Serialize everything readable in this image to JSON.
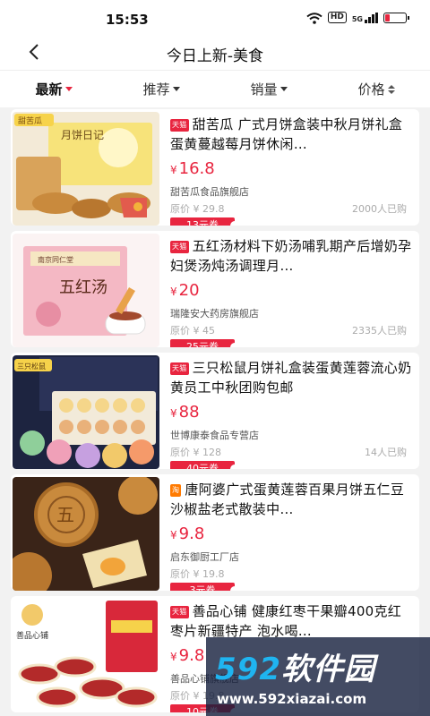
{
  "status": {
    "time": "15:53",
    "hd": "HD",
    "signal": "5G"
  },
  "nav": {
    "title": "今日上新-美食"
  },
  "tabs": [
    {
      "label": "最新",
      "active": true
    },
    {
      "label": "推荐"
    },
    {
      "label": "销量"
    },
    {
      "label": "价格"
    }
  ],
  "products": [
    {
      "badge": "天猫",
      "title": "甜苦瓜 广式月饼盒装中秋月饼礼盒蛋黄蔓越莓月饼休闲…",
      "price": "16.8",
      "shop": "甜苦瓜食品旗舰店",
      "original": "原价 ¥ 29.8",
      "sold": "2000人已购",
      "coupon": "13元券"
    },
    {
      "badge": "天猫",
      "title": "五红汤材料下奶汤哺乳期产后增奶孕妇煲汤炖汤调理月…",
      "price": "20",
      "shop": "瑞隆安大药房旗舰店",
      "original": "原价 ¥ 45",
      "sold": "2335人已购",
      "coupon": "25元券"
    },
    {
      "badge": "天猫",
      "title": "三只松鼠月饼礼盒装蛋黄莲蓉流心奶黄员工中秋团购包邮",
      "price": "88",
      "shop": "世博康泰食品专营店",
      "original": "原价 ¥ 128",
      "sold": "14人已购",
      "coupon": "40元券"
    },
    {
      "badge": "淘",
      "title": "唐阿婆广式蛋黄莲蓉百果月饼五仁豆沙椒盐老式散装中…",
      "price": "9.8",
      "shop": "启东御厨工厂店",
      "original": "原价 ¥ 19.8",
      "sold": "",
      "coupon": "3元券"
    },
    {
      "badge": "天猫",
      "title": "善品心铺 健康红枣干果瓣400克红枣片新疆特产 泡水喝…",
      "price": "9.8",
      "shop": "善品心铺旗舰店",
      "original": "原价 ¥ 19.8",
      "sold": "",
      "coupon": "10元券"
    }
  ],
  "images": {
    "p1_label": "甜苦瓜",
    "p1_box": "月饼日记",
    "p2_box": "五红汤",
    "p2_brand": "南京同仁堂",
    "p3_brand": "三只松鼠",
    "p3_mark": "五",
    "p5_brand": "善品心铺"
  },
  "watermark": {
    "logo_num": "592",
    "logo_text": "软件园",
    "url": "www.592xiazai.com"
  },
  "colors": {
    "accent": "#e8253f",
    "taobao": "#ff7a00"
  }
}
